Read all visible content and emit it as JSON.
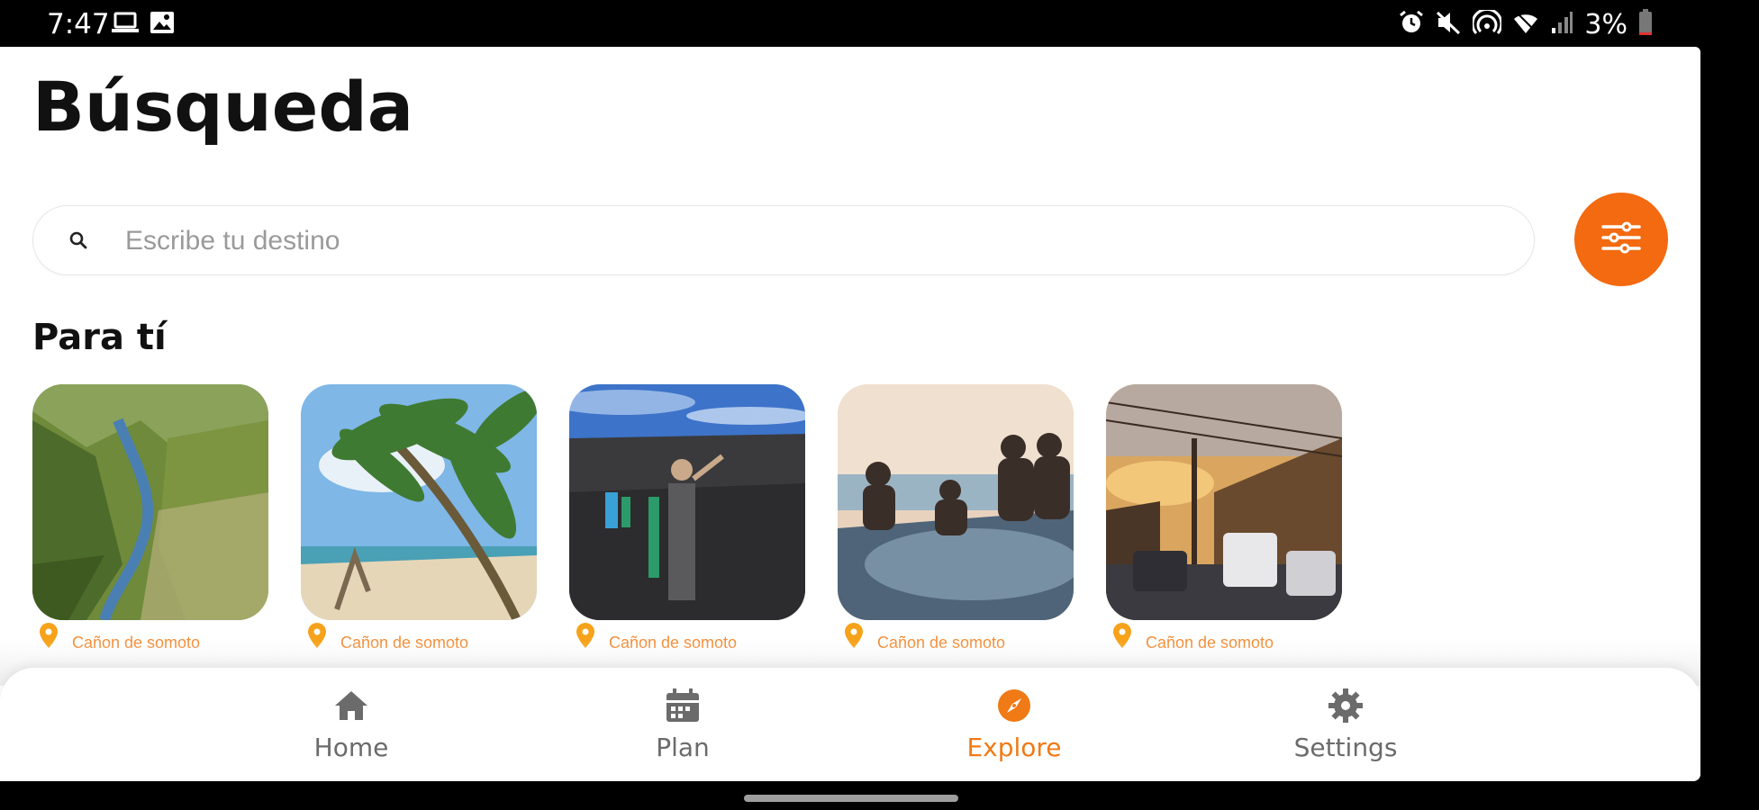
{
  "status_bar": {
    "time": "7:47",
    "battery": "3%",
    "left_icons": [
      "laptop-icon",
      "image-icon"
    ],
    "right_icons": [
      "alarm-icon",
      "mute-icon",
      "hotspot-icon",
      "wifi-icon",
      "signal-icon",
      "battery-icon"
    ]
  },
  "page": {
    "title": "Búsqueda"
  },
  "search": {
    "placeholder": "Escribe tu destino",
    "icon": "search-icon"
  },
  "filter_button": {
    "icon": "sliders-icon",
    "color": "#f36a10"
  },
  "section": {
    "title": "Para tí"
  },
  "cards": [
    {
      "label": "Cañon de somoto",
      "image": "canyon-river-photo"
    },
    {
      "label": "Cañon de somoto",
      "image": "palm-beach-photo"
    },
    {
      "label": "Cañon de somoto",
      "image": "volcano-sandboarding-photo"
    },
    {
      "label": "Cañon de somoto",
      "image": "friends-on-rock-photo"
    },
    {
      "label": "Cañon de somoto",
      "image": "colonial-street-sunset-photo"
    }
  ],
  "bottom_nav": {
    "active": "Explore",
    "accent_color": "#f07a16",
    "items": [
      {
        "label": "Home",
        "icon": "home-icon"
      },
      {
        "label": "Plan",
        "icon": "calendar-icon"
      },
      {
        "label": "Explore",
        "icon": "compass-icon"
      },
      {
        "label": "Settings",
        "icon": "gear-icon"
      }
    ]
  }
}
